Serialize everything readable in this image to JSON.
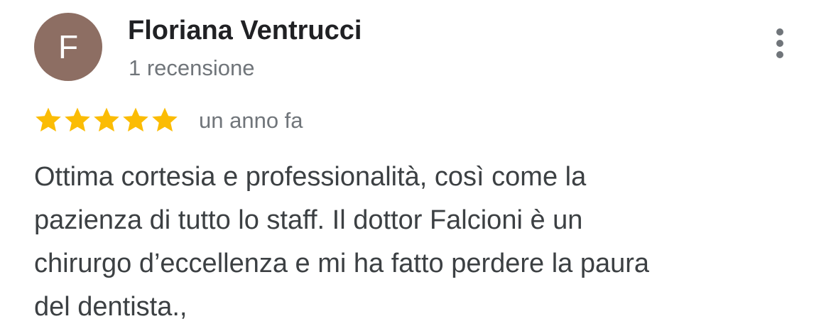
{
  "review": {
    "avatar_initial": "F",
    "avatar_color": "#8d6e63",
    "author_name": "Floriana Ventrucci",
    "review_count": "1 recensione",
    "more_icon": "more-vert-icon",
    "rating": 5,
    "rating_max": 5,
    "star_color": "#fbbc04",
    "star_icon": "star-icon",
    "date": "un anno fa",
    "text_lines": [
      "Ottima cortesia e professionalità, così come la",
      "pazienza di tutto lo staff. Il dottor Falcioni è un",
      "chirurgo d’eccellenza e mi ha fatto perdere la paura",
      "del dentista.,"
    ]
  }
}
